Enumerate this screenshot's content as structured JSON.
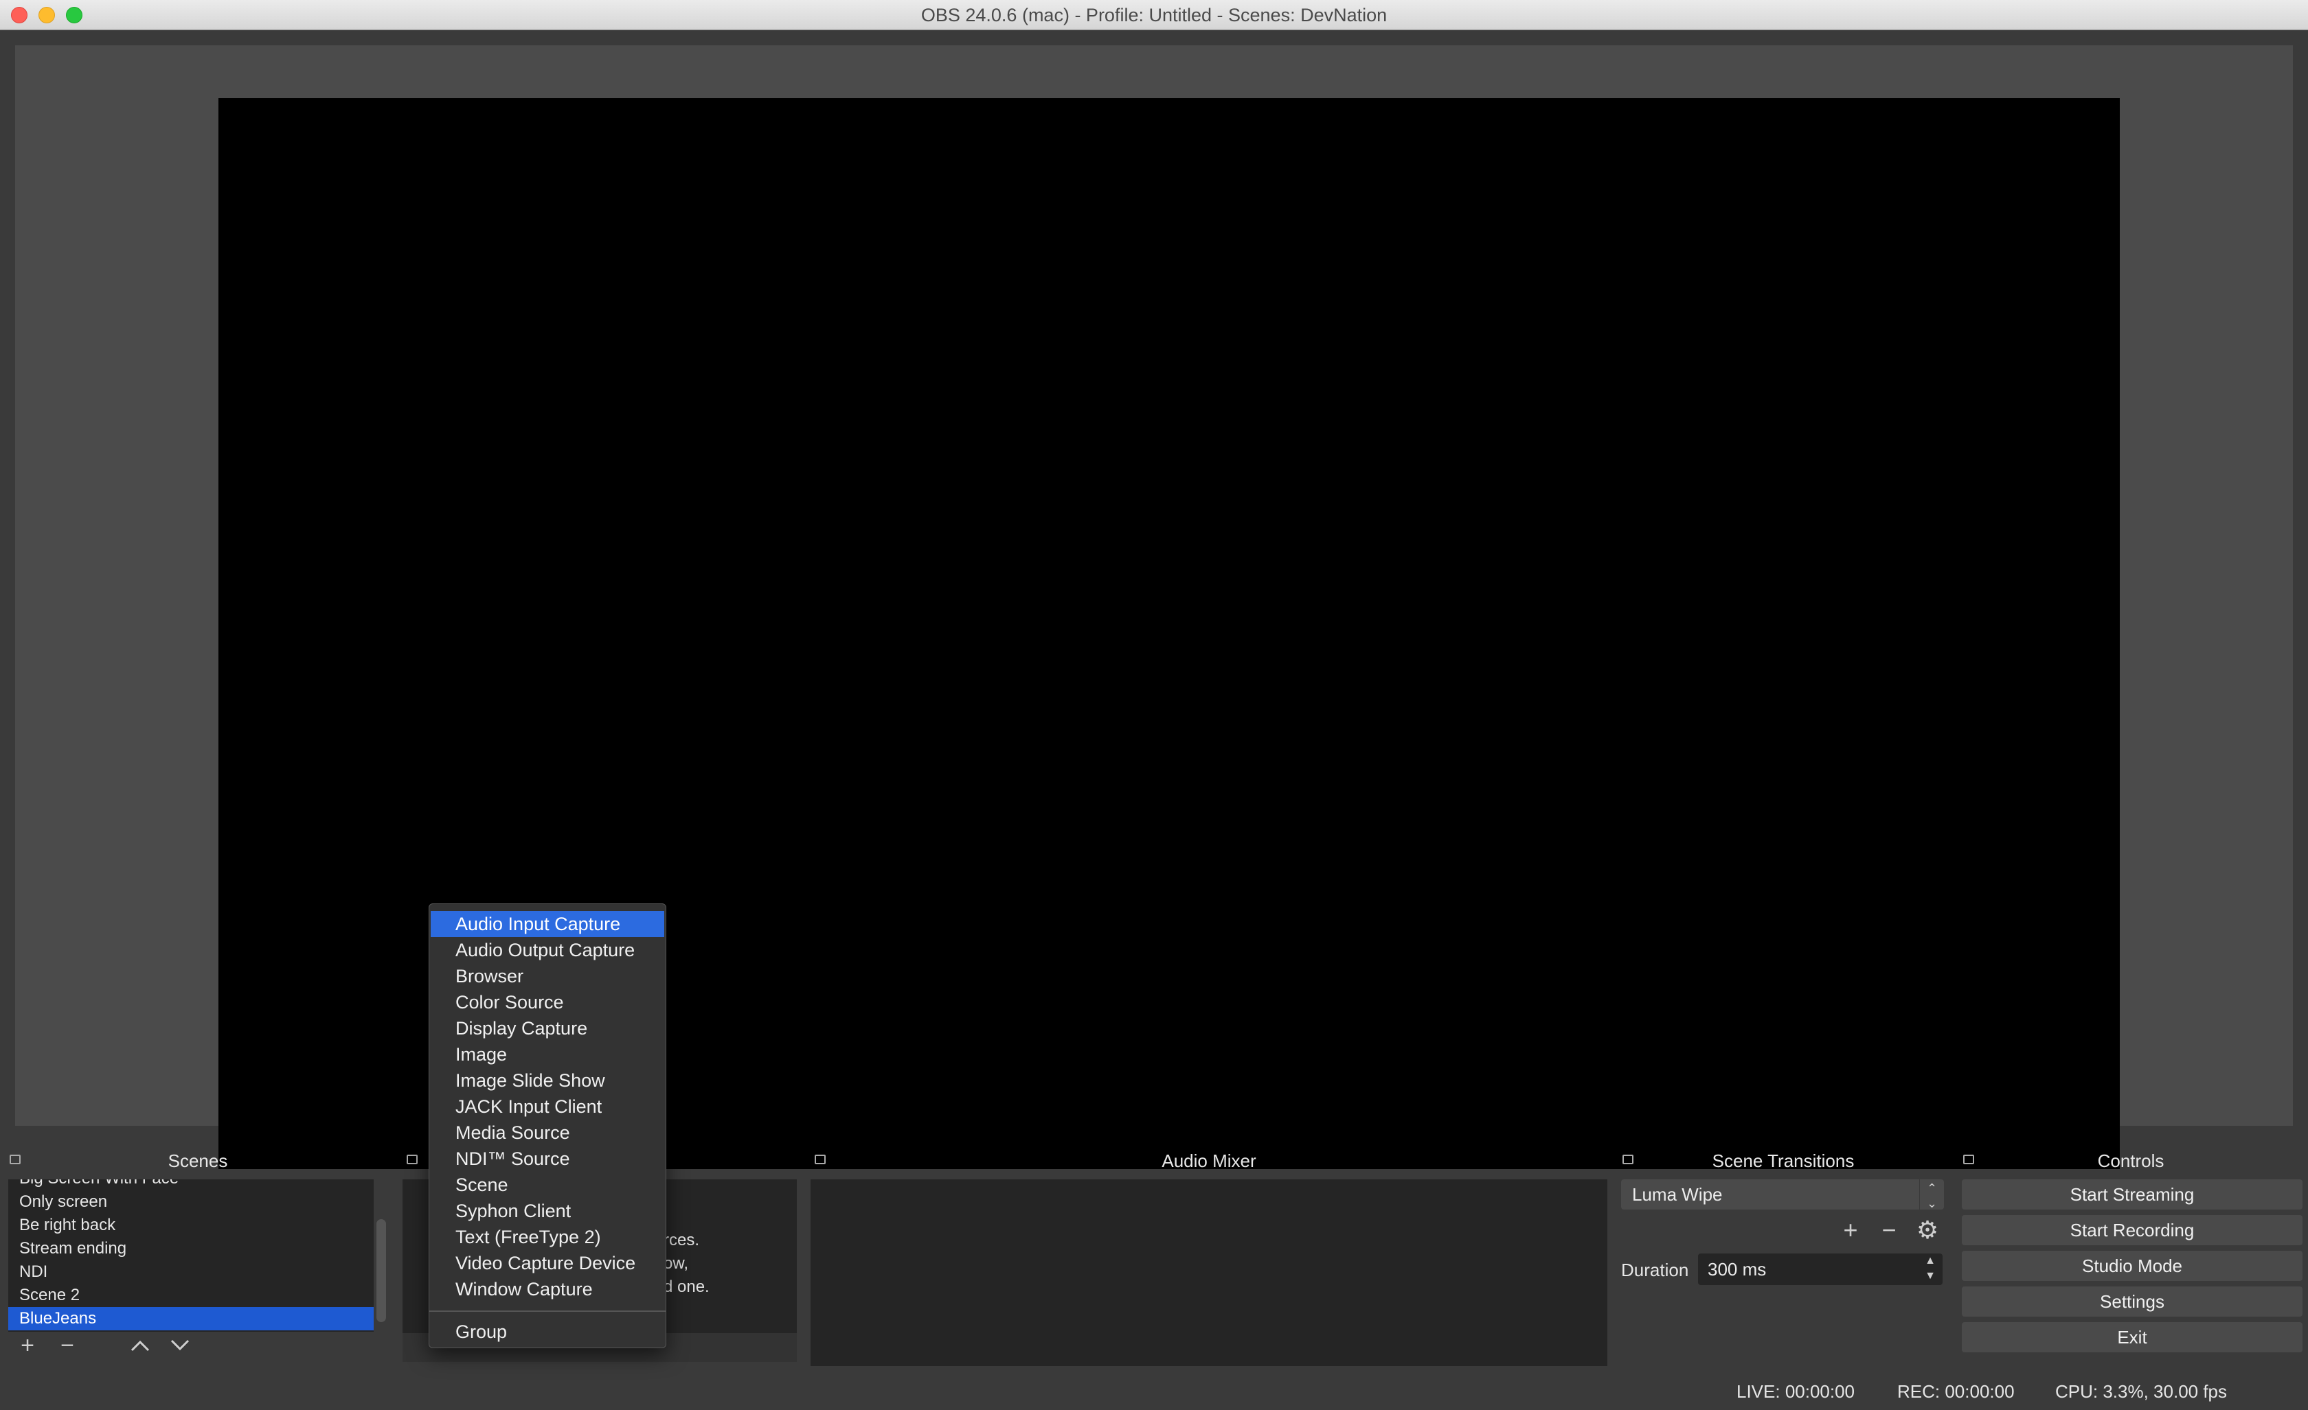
{
  "window": {
    "title": "OBS 24.0.6 (mac) - Profile: Untitled - Scenes: DevNation"
  },
  "scenes": {
    "header": "Scenes",
    "items": [
      "Big Screen With Face",
      "Only screen",
      "Be right back",
      "Stream ending",
      "NDI",
      "Scene 2",
      "BlueJeans"
    ],
    "selected": "BlueJeans"
  },
  "sources": {
    "hint_lines": [
      "rces.",
      "ow,",
      "d one."
    ]
  },
  "mixer": {
    "header": "Audio Mixer"
  },
  "transitions": {
    "header": "Scene Transitions",
    "selected": "Luma Wipe",
    "duration_label": "Duration",
    "duration_value": "300 ms"
  },
  "controls": {
    "header": "Controls",
    "buttons": [
      "Start Streaming",
      "Start Recording",
      "Studio Mode",
      "Settings",
      "Exit"
    ]
  },
  "status": {
    "live": "LIVE: 00:00:00",
    "rec": "REC: 00:00:00",
    "cpu": "CPU: 3.3%, 30.00 fps"
  },
  "context_menu": {
    "items": [
      "Audio Input Capture",
      "Audio Output Capture",
      "Browser",
      "Color Source",
      "Display Capture",
      "Image",
      "Image Slide Show",
      "JACK Input Client",
      "Media Source",
      "NDI™ Source",
      "Scene",
      "Syphon Client",
      "Text (FreeType 2)",
      "Video Capture Device",
      "Window Capture"
    ],
    "extra": "Group",
    "highlighted": "Audio Input Capture"
  },
  "icons": {
    "add": "plus-icon",
    "remove": "minus-icon",
    "up": "chevron-up-icon",
    "down": "chevron-down-icon",
    "settings": "gear-icon"
  },
  "colors": {
    "accent": "#2c6be0",
    "selection": "#1e5ad2"
  }
}
